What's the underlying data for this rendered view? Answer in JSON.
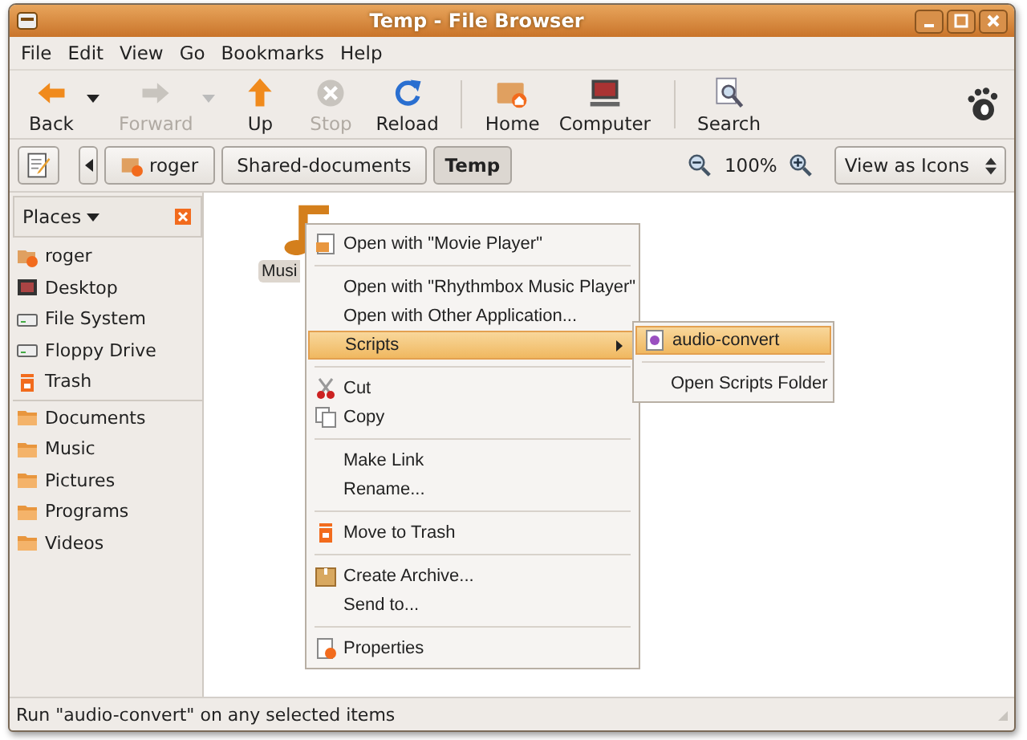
{
  "window": {
    "title": "Temp - File Browser"
  },
  "menu_bar": [
    "File",
    "Edit",
    "View",
    "Go",
    "Bookmarks",
    "Help"
  ],
  "toolbar": {
    "groups": [
      [
        {
          "label": "Back",
          "disabled": false,
          "dropdown": true
        },
        {
          "label": "Forward",
          "disabled": true,
          "dropdown": true
        },
        {
          "label": "Up",
          "disabled": false,
          "dropdown": false
        },
        {
          "label": "Stop",
          "disabled": true,
          "dropdown": false
        },
        {
          "label": "Reload",
          "disabled": false,
          "dropdown": false
        }
      ],
      [
        {
          "label": "Home",
          "disabled": false,
          "dropdown": false
        },
        {
          "label": "Computer",
          "disabled": false,
          "dropdown": false
        }
      ],
      [
        {
          "label": "Search",
          "disabled": false,
          "dropdown": false
        }
      ]
    ]
  },
  "location_bar": {
    "path": [
      {
        "label": "roger",
        "selected": false
      },
      {
        "label": "Shared-documents",
        "selected": false
      },
      {
        "label": "Temp",
        "selected": true
      }
    ],
    "zoom": "100%",
    "view": "View as Icons"
  },
  "sidebar": {
    "title": "Places",
    "groups": [
      [
        "roger",
        "Desktop",
        "File System",
        "Floppy Drive",
        "Trash"
      ],
      [
        "Documents",
        "Music",
        "Pictures",
        "Programs",
        "Videos"
      ]
    ]
  },
  "files": [
    {
      "label": "Musi",
      "selected": true
    }
  ],
  "context_menu": {
    "sections": [
      [
        {
          "label": "Open with \"Movie Player\"",
          "selected": false,
          "submenu": false
        }
      ],
      [
        {
          "label": "Open with \"Rhythmbox Music Player\"",
          "selected": false,
          "submenu": false
        },
        {
          "label": "Open with Other Application...",
          "selected": false,
          "submenu": false
        },
        {
          "label": "Scripts",
          "selected": true,
          "submenu": true
        }
      ],
      [
        {
          "label": "Cut",
          "selected": false,
          "submenu": false
        },
        {
          "label": "Copy",
          "selected": false,
          "submenu": false
        }
      ],
      [
        {
          "label": "Make Link",
          "selected": false,
          "submenu": false
        },
        {
          "label": "Rename...",
          "selected": false,
          "submenu": false
        }
      ],
      [
        {
          "label": "Move to Trash",
          "selected": false,
          "submenu": false
        }
      ],
      [
        {
          "label": "Create Archive...",
          "selected": false,
          "submenu": false
        },
        {
          "label": "Send to...",
          "selected": false,
          "submenu": false
        }
      ],
      [
        {
          "label": "Properties",
          "selected": false,
          "submenu": false
        }
      ]
    ],
    "submenu": [
      [
        {
          "label": "audio-convert",
          "selected": true
        }
      ],
      [
        {
          "label": "Open Scripts Folder",
          "selected": false
        }
      ]
    ]
  },
  "status_bar": "Run \"audio-convert\" on any selected items"
}
